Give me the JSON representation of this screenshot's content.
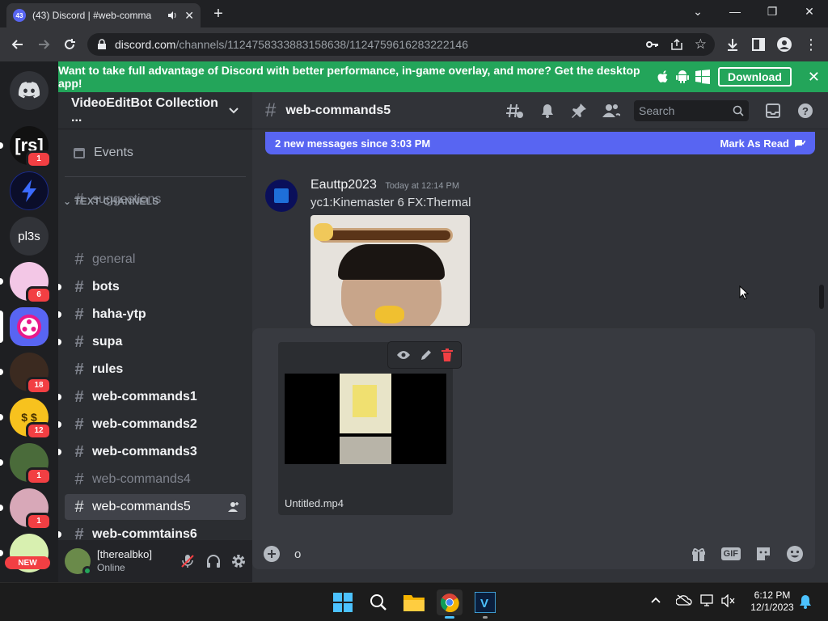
{
  "browser": {
    "tab_title": "(43) Discord | #web-comma",
    "tab_badge": "43",
    "url_host": "discord.com",
    "url_path": "/channels/1124758333883158638/1124759616283222146"
  },
  "banner": {
    "text": "Want to take full advantage of Discord with better performance, in-game overlay, and more? Get the desktop app!",
    "download_label": "Download"
  },
  "guilds": [
    {
      "label": "[rs]",
      "mentions": "1"
    },
    {
      "label": "",
      "mentions": ""
    },
    {
      "label": "pl3s",
      "mentions": ""
    },
    {
      "label": "",
      "mentions": "6"
    },
    {
      "label": "",
      "mentions": ""
    },
    {
      "label": "",
      "mentions": "18"
    },
    {
      "label": "$ $",
      "mentions": "12"
    },
    {
      "label": "",
      "mentions": "1"
    },
    {
      "label": "",
      "mentions": "1"
    },
    {
      "label": "",
      "mentions": "",
      "badge_text": "NEW"
    }
  ],
  "server": {
    "name": "VideoEditBot Collection ..."
  },
  "sidebar": {
    "events_label": "Events",
    "category": "TEXT CHANNELS",
    "channels": [
      {
        "name": "suggestions"
      },
      {
        "name": "general"
      },
      {
        "name": "bots"
      },
      {
        "name": "haha-ytp"
      },
      {
        "name": "supa"
      },
      {
        "name": "rules"
      },
      {
        "name": "web-commands1"
      },
      {
        "name": "web-commands2"
      },
      {
        "name": "web-commands3"
      },
      {
        "name": "web-commands4"
      },
      {
        "name": "web-commands5"
      },
      {
        "name": "web-commtains6"
      }
    ]
  },
  "user": {
    "name": "[therealbko]",
    "status": "Online"
  },
  "chat": {
    "channel": "web-commands5",
    "search_placeholder": "Search",
    "new_messages": "2 new messages since 3:03 PM",
    "mark_read": "Mark As Read",
    "message": {
      "author": "Eauttp2023",
      "timestamp": "Today at 12:14 PM",
      "text": "yc1:Kinemaster 6 FX:Thermal"
    },
    "attachment": {
      "filename": "Untitled.mp4"
    },
    "input_value": "o"
  },
  "taskbar": {
    "time": "6:12 PM",
    "date": "12/1/2023"
  },
  "colors": {
    "blurple": "#5865f2",
    "green": "#23a55a",
    "red": "#f23f43",
    "bg": "#313338"
  }
}
